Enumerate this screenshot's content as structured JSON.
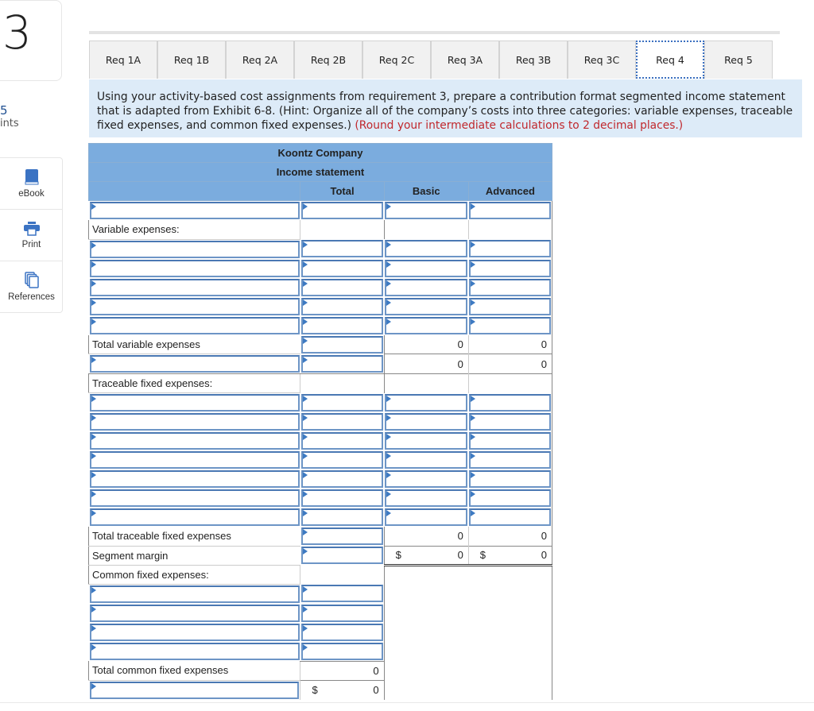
{
  "question": {
    "number": "3",
    "points_value": "5",
    "points_label": "oints"
  },
  "tools": [
    {
      "label": "eBook",
      "icon": "book-icon"
    },
    {
      "label": "Print",
      "icon": "printer-icon"
    },
    {
      "label": "References",
      "icon": "references-icon"
    }
  ],
  "tabs": [
    {
      "label": "Req 1A",
      "active": false
    },
    {
      "label": "Req 1B",
      "active": false
    },
    {
      "label": "Req 2A",
      "active": false
    },
    {
      "label": "Req 2B",
      "active": false
    },
    {
      "label": "Req 2C",
      "active": false
    },
    {
      "label": "Req 3A",
      "active": false
    },
    {
      "label": "Req 3B",
      "active": false
    },
    {
      "label": "Req 3C",
      "active": false
    },
    {
      "label": "Req 4",
      "active": true
    },
    {
      "label": "Req 5",
      "active": false
    }
  ],
  "instructions": {
    "text": "Using your activity-based cost assignments from requirement 3, prepare a contribution format segmented income statement that is adapted from Exhibit 6-8. (Hint: Organize all of the company’s costs into three categories: variable expenses, traceable fixed expenses, and common fixed expenses.) ",
    "note": "(Round your intermediate calculations to 2 decimal places.)"
  },
  "statement": {
    "company": "Koontz Company",
    "title": "Income statement",
    "columns": [
      "",
      "Total",
      "Basic",
      "Advanced"
    ],
    "labels": {
      "variable_expenses": "Variable expenses:",
      "total_variable": "Total variable expenses",
      "traceable_fixed": "Traceable fixed expenses:",
      "total_traceable": "Total traceable fixed expenses",
      "segment_margin": "Segment margin",
      "common_fixed": "Common fixed expenses:",
      "total_common": "Total common fixed expenses"
    },
    "values": {
      "total_variable_basic": "0",
      "total_variable_advanced": "0",
      "cm_basic": "0",
      "cm_advanced": "0",
      "total_traceable_basic": "0",
      "total_traceable_advanced": "0",
      "segment_margin_basic": "0",
      "segment_margin_advanced": "0",
      "total_common_total": "0",
      "net_operating_income_total": "0"
    },
    "currency_symbol": "$"
  }
}
